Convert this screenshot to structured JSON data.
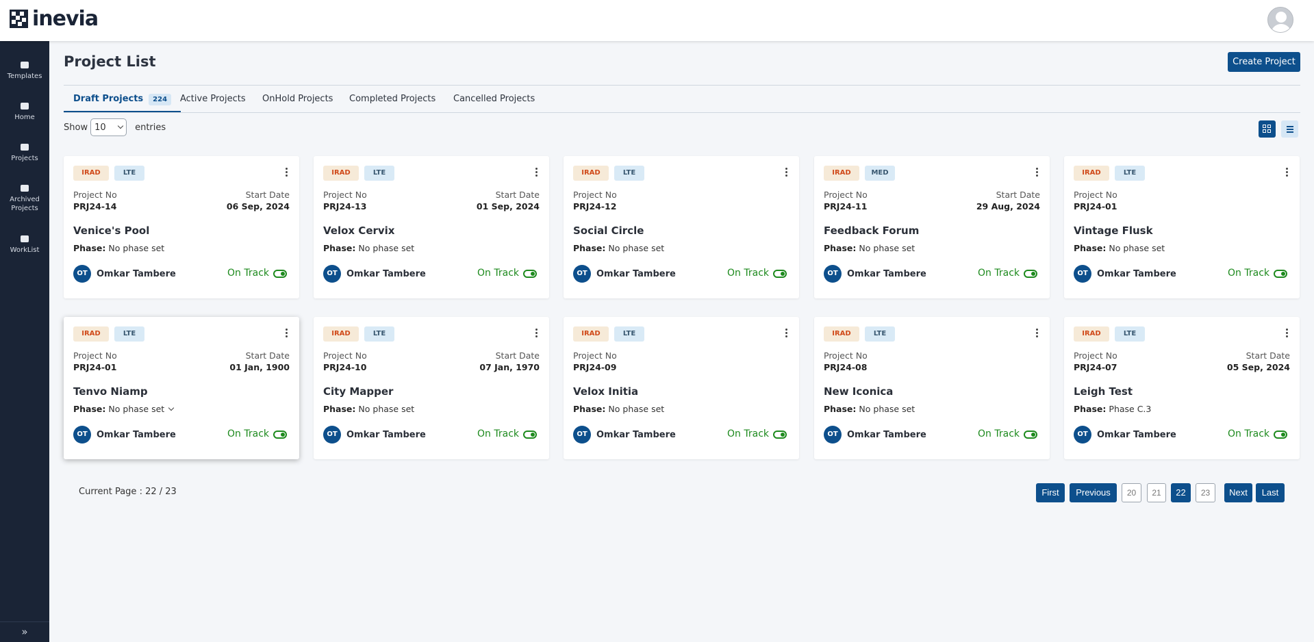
{
  "brand": {
    "name": "inevia"
  },
  "sidebar": {
    "items": [
      {
        "label": "Templates"
      },
      {
        "label": "Home"
      },
      {
        "label": "Projects"
      },
      {
        "label": "Archived Projects"
      },
      {
        "label": "WorkList"
      }
    ],
    "expand_icon": "»"
  },
  "header": {
    "title": "Project List",
    "create_label": "Create Project"
  },
  "tabs": [
    {
      "label": "Draft Projects",
      "badge": "224"
    },
    {
      "label": "Active Projects"
    },
    {
      "label": "OnHold Projects"
    },
    {
      "label": "Completed Projects"
    },
    {
      "label": "Cancelled Projects"
    }
  ],
  "entries": {
    "show_label": "Show",
    "selected": "10",
    "suffix": "entries"
  },
  "card_labels": {
    "project_no": "Project No",
    "start_date": "Start Date",
    "phase": "Phase:"
  },
  "cards": [
    {
      "tag1": "IRAD",
      "tag2": "LTE",
      "project_no": "PRJ24-14",
      "start_date": "06 Sep, 2024",
      "name": "Venice's Pool",
      "phase": "No phase set",
      "initials": "OT",
      "owner": "Omkar Tambere",
      "status": "On Track"
    },
    {
      "tag1": "IRAD",
      "tag2": "LTE",
      "project_no": "PRJ24-13",
      "start_date": "01 Sep, 2024",
      "name": "Velox Cervix",
      "phase": "No phase set",
      "initials": "OT",
      "owner": "Omkar Tambere",
      "status": "On Track"
    },
    {
      "tag1": "IRAD",
      "tag2": "LTE",
      "project_no": "PRJ24-12",
      "start_date": "",
      "name": "Social Circle",
      "phase": "No phase set",
      "initials": "OT",
      "owner": "Omkar Tambere",
      "status": "On Track"
    },
    {
      "tag1": "IRAD",
      "tag2": "MED",
      "project_no": "PRJ24-11",
      "start_date": "29 Aug, 2024",
      "name": "Feedback Forum",
      "phase": "No phase set",
      "initials": "OT",
      "owner": "Omkar Tambere",
      "status": "On Track"
    },
    {
      "tag1": "IRAD",
      "tag2": "LTE",
      "project_no": "PRJ24-01",
      "start_date": "",
      "name": "Vintage Flusk",
      "phase": "No phase set",
      "initials": "OT",
      "owner": "Omkar Tambere",
      "status": "On Track"
    },
    {
      "tag1": "IRAD",
      "tag2": "LTE",
      "project_no": "PRJ24-01",
      "start_date": "01 Jan, 1900",
      "name": "Tenvo Niamp",
      "phase": "No phase set",
      "initials": "OT",
      "owner": "Omkar Tambere",
      "status": "On Track"
    },
    {
      "tag1": "IRAD",
      "tag2": "LTE",
      "project_no": "PRJ24-10",
      "start_date": "07 Jan, 1970",
      "name": "City Mapper",
      "phase": "No phase set",
      "initials": "OT",
      "owner": "Omkar Tambere",
      "status": "On Track"
    },
    {
      "tag1": "IRAD",
      "tag2": "LTE",
      "project_no": "PRJ24-09",
      "start_date": "",
      "name": "Velox Initia",
      "phase": "No phase set",
      "initials": "OT",
      "owner": "Omkar Tambere",
      "status": "On Track"
    },
    {
      "tag1": "IRAD",
      "tag2": "LTE",
      "project_no": "PRJ24-08",
      "start_date": "",
      "name": "New Iconica",
      "phase": "No phase set",
      "initials": "OT",
      "owner": "Omkar Tambere",
      "status": "On Track"
    },
    {
      "tag1": "IRAD",
      "tag2": "LTE",
      "project_no": "PRJ24-07",
      "start_date": "05 Sep, 2024",
      "name": "Leigh Test",
      "phase": "Phase C.3",
      "initials": "OT",
      "owner": "Omkar Tambere",
      "status": "On Track"
    }
  ],
  "pagination": {
    "current_label": "Current Page : 22 / 23",
    "first": "First",
    "previous": "Previous",
    "pages": [
      "20",
      "21",
      "22",
      "23"
    ],
    "active_page": "22",
    "next": "Next",
    "last": "Last"
  }
}
